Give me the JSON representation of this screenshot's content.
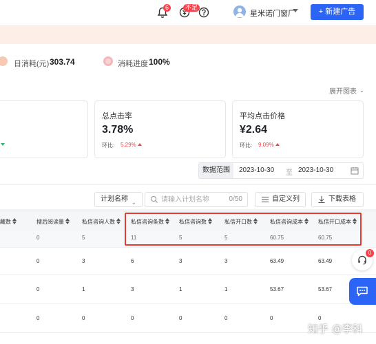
{
  "header": {
    "notification_badge": "6",
    "balance_badge": "不足",
    "company_name": "星米诺门窗厂",
    "new_ad_button": "新建广告"
  },
  "stats": {
    "daily_cost_label": "日消耗(元)",
    "daily_cost_value": "303.74",
    "progress_label": "消耗进度",
    "progress_value": "100%"
  },
  "chart_panel": {
    "expand_label": "展开图表",
    "cards": [
      {
        "title": "总点击率",
        "value": "3.78%",
        "ring_label": "环比:",
        "ring_value": "5.29%"
      },
      {
        "title": "平均点击价格",
        "value": "¥2.64",
        "ring_label": "环比:",
        "ring_value": "9.09%"
      }
    ],
    "date_range": {
      "label": "数据范围",
      "start": "2023-10-30",
      "separator": "至",
      "end": "2023-10-30"
    }
  },
  "toolbar": {
    "plan_select_value": "计划名称",
    "search_placeholder": "请输入计划名称",
    "search_count": "0/50",
    "custom_columns": "自定义列",
    "download_table": "下载表格"
  },
  "table": {
    "columns": [
      "记藏数",
      "搜后阅读量",
      "私信咨询人数",
      "私信咨询条数",
      "私信咨询数",
      "私信开口数",
      "私信咨询成本",
      "私信开口成本"
    ],
    "summary": [
      "",
      "0",
      "5",
      "11",
      "5",
      "5",
      "60.75",
      "60.75"
    ],
    "rows": [
      [
        "",
        "0",
        "3",
        "6",
        "3",
        "3",
        "63.49",
        "63.49"
      ],
      [
        "",
        "0",
        "1",
        "3",
        "1",
        "1",
        "53.67",
        "53.67"
      ],
      [
        "",
        "0",
        "0",
        "0",
        "0",
        "0",
        "0",
        "0"
      ]
    ]
  },
  "floating": {
    "support_badge": "0"
  },
  "watermark": "知乎 @李科",
  "colors": {
    "primary": "#2c64f5",
    "banner": "#fdeee8",
    "up_red": "#e8494b",
    "highlight": "#e53a2f"
  }
}
